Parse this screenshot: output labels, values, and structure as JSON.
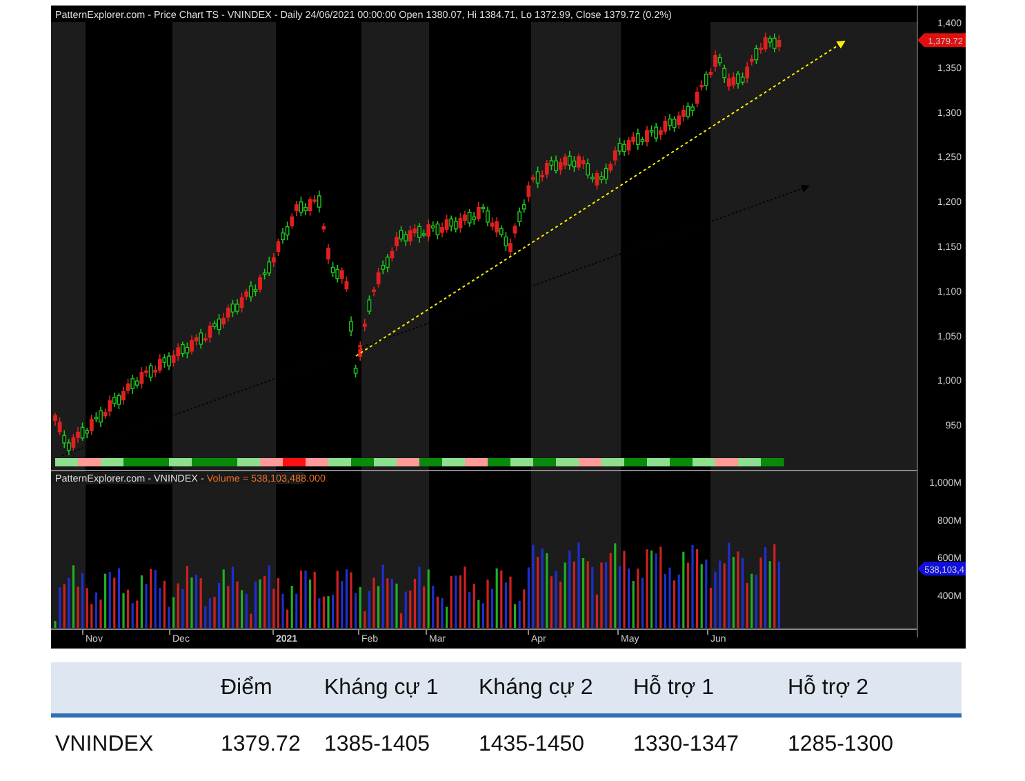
{
  "chart": {
    "title": "PatternExplorer.com - Price Chart TS - VNINDEX - Daily 24/06/2021 00:00:00 Open 1380.07, Hi 1384.71, Lo 1372.99, Close 1379.72 (0.2%)",
    "price_ticks": [
      "1,400",
      "1,350",
      "1,300",
      "1,250",
      "1,200",
      "1,150",
      "1,100",
      "1,050",
      "1,000",
      "950"
    ],
    "last_price": "1,379.72",
    "volume_title": "PatternExplorer.com - VNINDEX - ",
    "volume_reading": "Volume = 538,103,488.000",
    "volume_ticks": [
      "1,000M",
      "800M",
      "600M",
      "400M"
    ],
    "last_volume": "538,103,4",
    "months": [
      {
        "label": "Nov",
        "kind": "month"
      },
      {
        "label": "Dec",
        "kind": "month"
      },
      {
        "label": "2021",
        "kind": "year"
      },
      {
        "label": "Feb",
        "kind": "month"
      },
      {
        "label": "Mar",
        "kind": "month"
      },
      {
        "label": "Apr",
        "kind": "month"
      },
      {
        "label": "May",
        "kind": "month"
      },
      {
        "label": "Jun",
        "kind": "month"
      }
    ]
  },
  "table": {
    "columns": [
      "Điểm",
      "Kháng cự 1",
      "Kháng cự 2",
      "Hỗ trợ 1",
      "Hỗ trợ 2"
    ],
    "rows": [
      {
        "name": "VNINDEX",
        "cells": [
          "1379.72",
          "1385-1405",
          "1435-1450",
          "1330-1347",
          "1285-1300"
        ]
      }
    ]
  }
}
